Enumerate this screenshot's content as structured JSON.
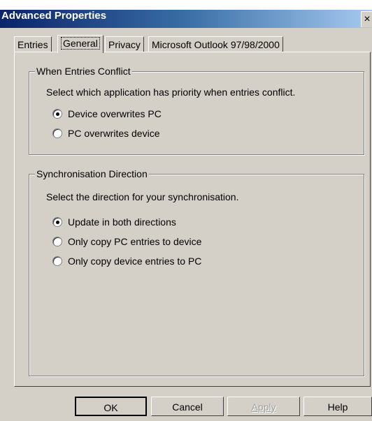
{
  "window": {
    "title": "Advanced Properties",
    "close_glyph": "×"
  },
  "tabs": [
    {
      "label": "Entries",
      "active": false
    },
    {
      "label": "General",
      "active": true
    },
    {
      "label": "Privacy",
      "active": false
    },
    {
      "label": "Microsoft Outlook 97/98/2000",
      "active": false
    }
  ],
  "conflict": {
    "legend": "When Entries Conflict",
    "description": "Select which application has priority when entries conflict.",
    "options": [
      {
        "label": "Device overwrites PC",
        "checked": true
      },
      {
        "label": "PC overwrites device",
        "checked": false
      }
    ]
  },
  "direction": {
    "legend": "Synchronisation Direction",
    "description": "Select the direction for your synchronisation.",
    "options": [
      {
        "label": "Update in both directions",
        "checked": true
      },
      {
        "label": "Only copy PC entries to device",
        "checked": false
      },
      {
        "label": "Only copy device entries to PC",
        "checked": false
      }
    ]
  },
  "buttons": {
    "ok": "OK",
    "cancel": "Cancel",
    "apply": "Apply",
    "help": "Help"
  },
  "colors": {
    "face": "#d4d0c8",
    "title_start": "#0a246a",
    "title_end": "#a6caf0"
  }
}
